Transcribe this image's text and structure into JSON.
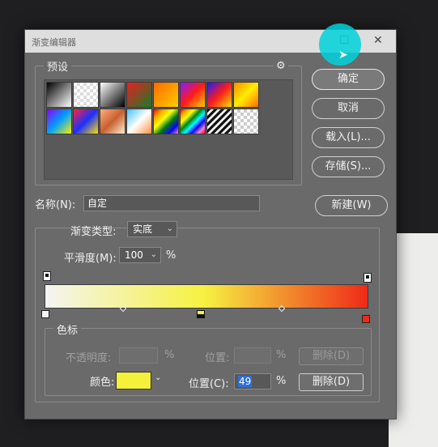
{
  "window": {
    "title": "渐变编辑器",
    "max_glyph": "☐",
    "close_glyph": "✕"
  },
  "presets": {
    "legend": "预设",
    "gear_glyph": "⚙",
    "swatches": [
      "linear-gradient(135deg,#000,#fff)",
      "repeating-conic-gradient(#ddd 0 25%,#fff 0 50%) 0 0/8px 8px",
      "linear-gradient(135deg,#fff,#000)",
      "linear-gradient(135deg,#e82020,#1a7a2a)",
      "linear-gradient(135deg,#ff6a00,#ffcc00)",
      "linear-gradient(135deg,#8a1aff,#ff1a1a,#ffd000)",
      "linear-gradient(135deg,#1a1aff,#ff1a1a,#ffe000)",
      "linear-gradient(135deg,#ff8a00,#ffee00,#ff6a00)",
      "linear-gradient(135deg,#8a00ff,#00a0ff,#ffee00)",
      "linear-gradient(135deg,#ff2040,#1a30ff,#ffe000)",
      "linear-gradient(135deg,#ffb080,#c86030,#fff0d0)",
      "linear-gradient(135deg,#40c0ff,#ffffff,#ff9040)",
      "linear-gradient(135deg,red,orange,yellow,green,blue,violet)",
      "linear-gradient(135deg,red,orange,yellow,green,cyan,blue,violet,red)",
      "repeating-linear-gradient(135deg,#111 0 3px,#eee 3px 6px)",
      "repeating-conic-gradient(#ccc 0 25%,#fff 0 50%) 0 0/8px 8px"
    ]
  },
  "buttons": {
    "ok": "确定",
    "cancel": "取消",
    "load": "载入(L)...",
    "save": "存储(S)...",
    "new": "新建(W)"
  },
  "name": {
    "label": "名称(N):",
    "value": "自定"
  },
  "gradient": {
    "type_label": "渐变类型:",
    "type_value": "实底",
    "smooth_label": "平滑度(M):",
    "smooth_value": "100",
    "percent": "%",
    "colors": [
      "#f4f4f2",
      "#f6f242",
      "#ee2a18"
    ]
  },
  "color_stops": {
    "legend": "色标",
    "opacity_label": "不透明度:",
    "opacity_unit": "%",
    "opacity_location_label": "位置:",
    "opacity_location_unit": "%",
    "opacity_delete": "删除(D)",
    "color_label": "颜色:",
    "color_value": "#f5f03a",
    "location_label": "位置(C):",
    "location_value": "49",
    "location_unit": "%",
    "delete": "删除(D)"
  },
  "cursor_glyph": "➤"
}
